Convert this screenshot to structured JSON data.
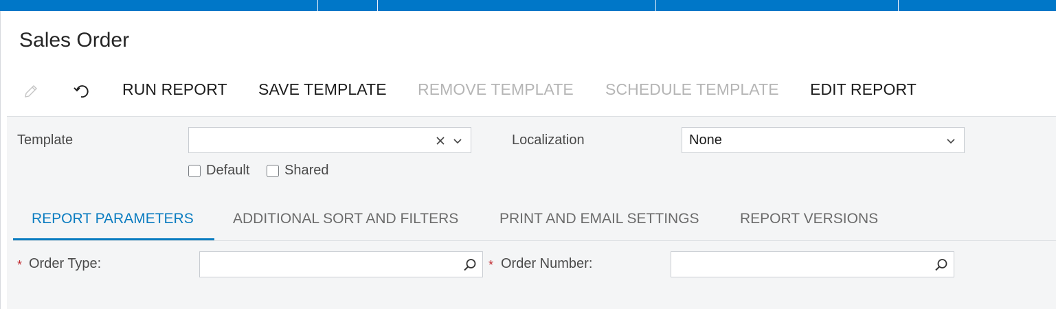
{
  "page_title": "Sales Order",
  "toolbar": {
    "edit_icon": "pencil-icon",
    "undo_icon": "undo-icon",
    "run_report": "RUN REPORT",
    "save_template": "SAVE TEMPLATE",
    "remove_template": "REMOVE TEMPLATE",
    "schedule_template": "SCHEDULE TEMPLATE",
    "edit_report": "EDIT REPORT"
  },
  "template": {
    "label": "Template",
    "value": "",
    "clear_icon": "close-icon",
    "dropdown_icon": "chevron-down-icon",
    "default_label": "Default",
    "default_checked": false,
    "shared_label": "Shared",
    "shared_checked": false
  },
  "localization": {
    "label": "Localization",
    "value": "None",
    "dropdown_icon": "chevron-down-icon"
  },
  "tabs": [
    {
      "label": "REPORT PARAMETERS",
      "active": true
    },
    {
      "label": "ADDITIONAL SORT AND FILTERS",
      "active": false
    },
    {
      "label": "PRINT AND EMAIL SETTINGS",
      "active": false
    },
    {
      "label": "REPORT VERSIONS",
      "active": false
    }
  ],
  "parameters": {
    "required_marker": "*",
    "order_type_label": "Order Type:",
    "order_type_value": "",
    "order_number_label": "Order Number:",
    "order_number_value": "",
    "search_icon": "search-icon"
  },
  "colors": {
    "accent": "#0077c8",
    "active_tab": "#0a7cc0",
    "required": "#c0282e",
    "disabled_text": "#b5b5b5"
  }
}
